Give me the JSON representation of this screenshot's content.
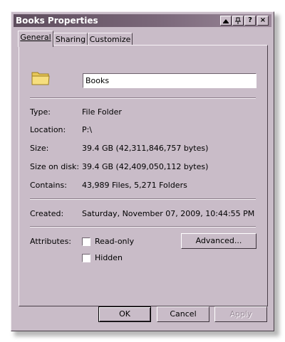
{
  "window": {
    "title": "Books Properties",
    "caption_buttons": {
      "help": "?",
      "close": "×"
    }
  },
  "tabs": [
    {
      "label": "General",
      "active": true
    },
    {
      "label": "Sharing",
      "active": false
    },
    {
      "label": "Customize",
      "active": false
    }
  ],
  "general": {
    "icon": "folder-icon",
    "name": "Books",
    "properties": [
      {
        "label": "Type:",
        "value": "File Folder"
      },
      {
        "label": "Location:",
        "value": "P:\\"
      },
      {
        "label": "Size:",
        "value": "39.4 GB (42,311,846,757 bytes)"
      },
      {
        "label": "Size on disk:",
        "value": "39.4 GB (42,409,050,112 bytes)"
      },
      {
        "label": "Contains:",
        "value": "43,989 Files, 5,271 Folders"
      }
    ],
    "created": {
      "label": "Created:",
      "value": "Saturday, November 07, 2009, 10:44:55 PM"
    },
    "attributes": {
      "label": "Attributes:",
      "read_only": {
        "label": "Read-only",
        "checked": false
      },
      "hidden": {
        "label": "Hidden",
        "checked": false
      },
      "advanced_label": "Advanced..."
    }
  },
  "footer": {
    "ok": "OK",
    "cancel": "Cancel",
    "apply": "Apply"
  },
  "colors": {
    "face": "#c9bcc8",
    "title_start": "#5e4d5d",
    "title_end": "#9b899a"
  }
}
